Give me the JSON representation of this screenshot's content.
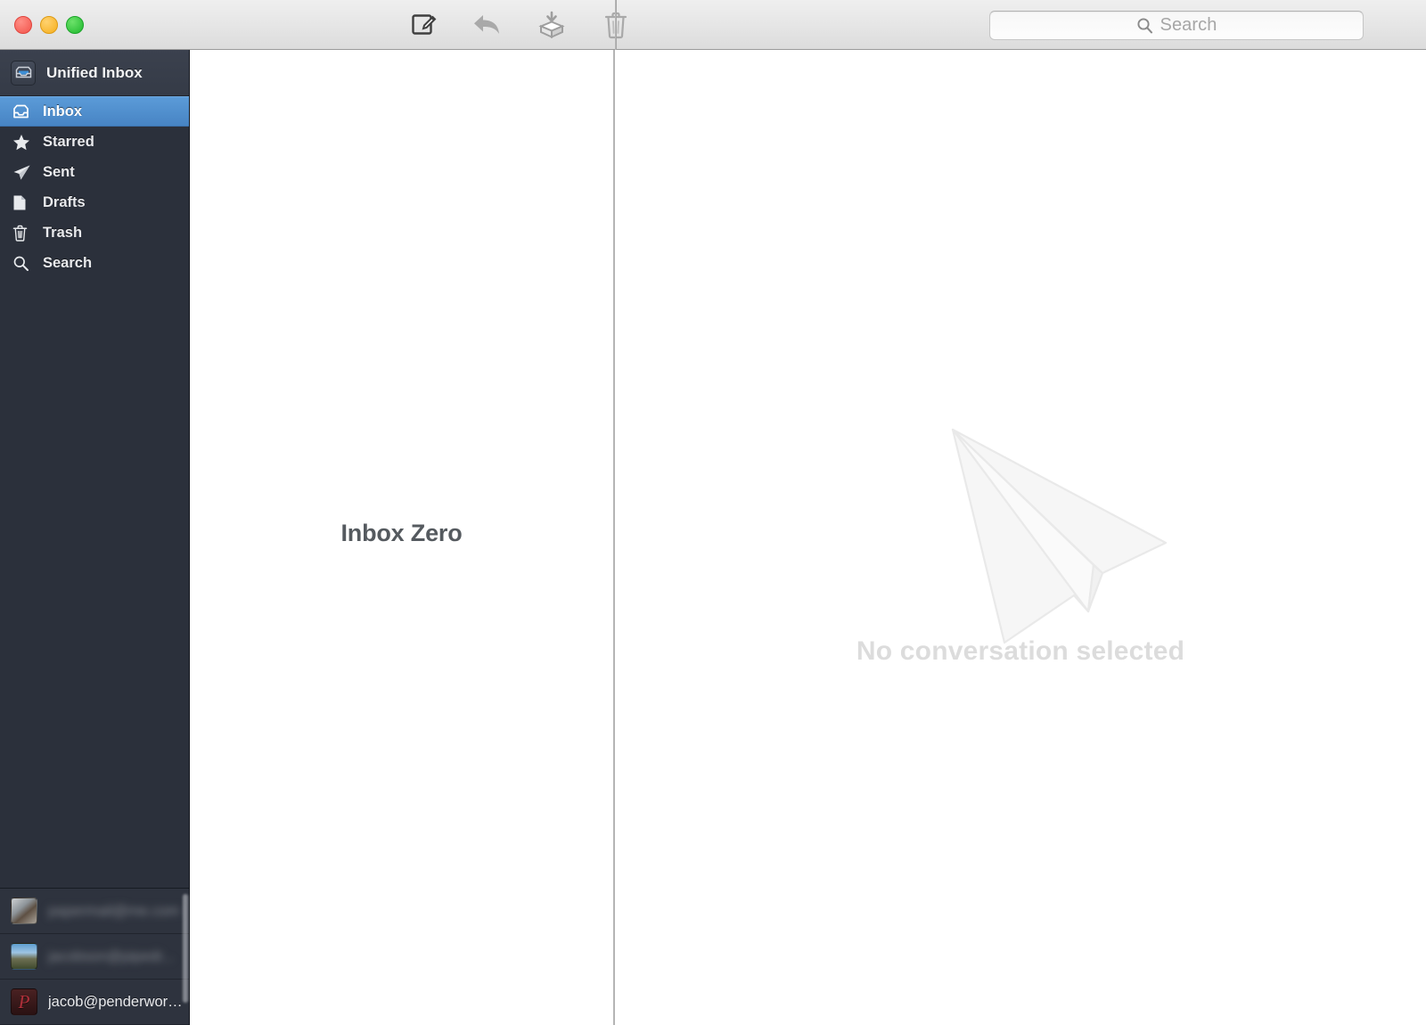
{
  "window": {
    "traffic_lights": [
      {
        "name": "close",
        "color": "#f2544b"
      },
      {
        "name": "minimize",
        "color": "#f5ae1c"
      },
      {
        "name": "maximize",
        "color": "#1fb82e"
      }
    ]
  },
  "toolbar": {
    "actions": [
      {
        "name": "compose",
        "icon": "compose-icon",
        "label": "Compose"
      },
      {
        "name": "reply",
        "icon": "reply-icon",
        "label": "Reply"
      },
      {
        "name": "archive",
        "icon": "archive-icon",
        "label": "Archive"
      },
      {
        "name": "delete",
        "icon": "trash-icon",
        "label": "Delete"
      }
    ]
  },
  "search": {
    "placeholder": "Search",
    "value": "",
    "icon": "search-icon"
  },
  "sidebar": {
    "header": {
      "label": "Unified Inbox",
      "icon": "unified-inbox-icon"
    },
    "items": [
      {
        "label": "Inbox",
        "icon": "inbox-icon",
        "selected": true
      },
      {
        "label": "Starred",
        "icon": "star-icon",
        "selected": false
      },
      {
        "label": "Sent",
        "icon": "send-icon",
        "selected": false
      },
      {
        "label": "Drafts",
        "icon": "document-icon",
        "selected": false
      },
      {
        "label": "Trash",
        "icon": "trash-icon",
        "selected": false
      },
      {
        "label": "Search",
        "icon": "search-icon",
        "selected": false
      }
    ],
    "accent_color": "#4784c4",
    "background_color": "#2b303b",
    "accounts": [
      {
        "label": "papermail@me.com",
        "redacted": true,
        "avatar": "photo-avatar"
      },
      {
        "label": "jacobson@pipedr...",
        "redacted": true,
        "avatar": "photo-avatar"
      },
      {
        "label": "jacob@penderwor…",
        "redacted": false,
        "avatar": "letter-p-avatar"
      }
    ]
  },
  "list_pane": {
    "empty_title": "Inbox Zero"
  },
  "reading_pane": {
    "empty_text": "No conversation selected",
    "illustration": "paper-plane-illustration"
  }
}
